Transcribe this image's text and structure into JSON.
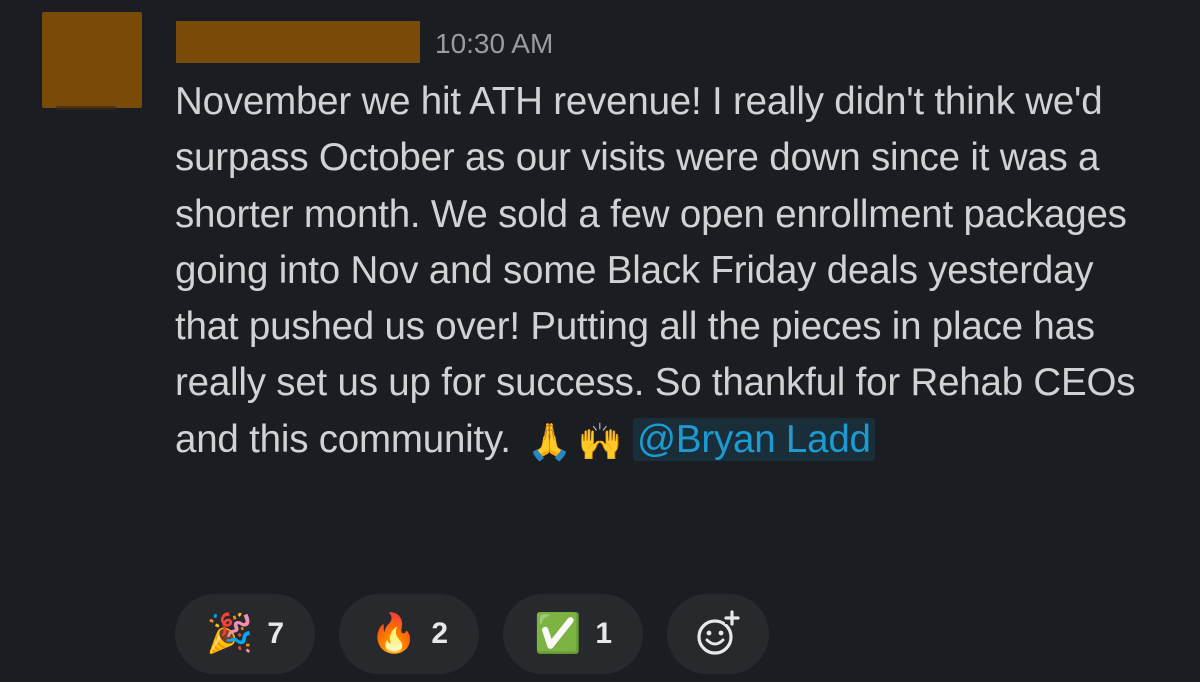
{
  "message": {
    "timestamp": "10:30 AM",
    "text": "November we hit ATH revenue! I really didn't think we'd surpass October as our visits were down since it was a shorter month. We sold a few open enrollment packages going into Nov and some Black Friday deals yesterday that pushed us over! Putting all the pieces in place has really set us up for success. So thankful for Rehab CEOs and this community.",
    "inline_emojis": [
      "🙏",
      "🙌"
    ],
    "mention": "@Bryan Ladd"
  },
  "reactions": [
    {
      "emoji": "🎉",
      "icon": "party-popper-icon",
      "count": "7"
    },
    {
      "emoji": "🔥",
      "icon": "fire-icon",
      "count": "2"
    },
    {
      "emoji": "✅",
      "icon": "check-mark-button-icon",
      "count": "1"
    }
  ],
  "colors": {
    "background": "#1a1d21",
    "text": "#d1d2d3",
    "timestamp": "#9a9b9e",
    "mention": "#1d9bd1",
    "redaction": "#7a4a08",
    "reaction_pill": "#27292d"
  }
}
